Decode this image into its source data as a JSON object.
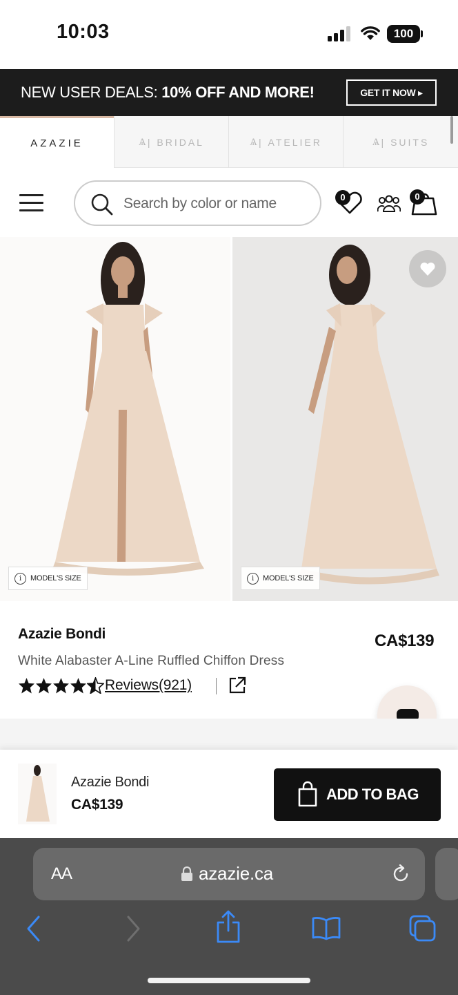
{
  "status_bar": {
    "time": "10:03",
    "battery": "100"
  },
  "promo": {
    "text_regular": "NEW USER DEALS:",
    "text_bold": "10% OFF AND MORE!",
    "cta": "GET IT NOW ▸"
  },
  "brand_tabs": [
    {
      "label": "AZAZIE",
      "active": true
    },
    {
      "label": "BRIDAL",
      "active": false
    },
    {
      "label": "ATELIER",
      "active": false
    },
    {
      "label": "SUITS",
      "active": false
    }
  ],
  "header": {
    "search_placeholder": "Search by color or name",
    "wishlist_count": "0",
    "cart_count": "0"
  },
  "gallery": {
    "model_size_label": "MODEL'S SIZE"
  },
  "product": {
    "name": "Azazie Bondi",
    "description": "White Alabaster A-Line Ruffled Chiffon Dress",
    "price": "CA$139",
    "rating": 4.5,
    "reviews_label": "Reviews(921)"
  },
  "sticky_bar": {
    "name": "Azazie Bondi",
    "price": "CA$139",
    "add_label": "ADD TO BAG"
  },
  "browser": {
    "text_size_label": "AA",
    "address": "azazie.ca"
  },
  "colors": {
    "accent_tab": "#d9b9a4",
    "dark": "#111111",
    "dress": "#ecd8c6"
  }
}
